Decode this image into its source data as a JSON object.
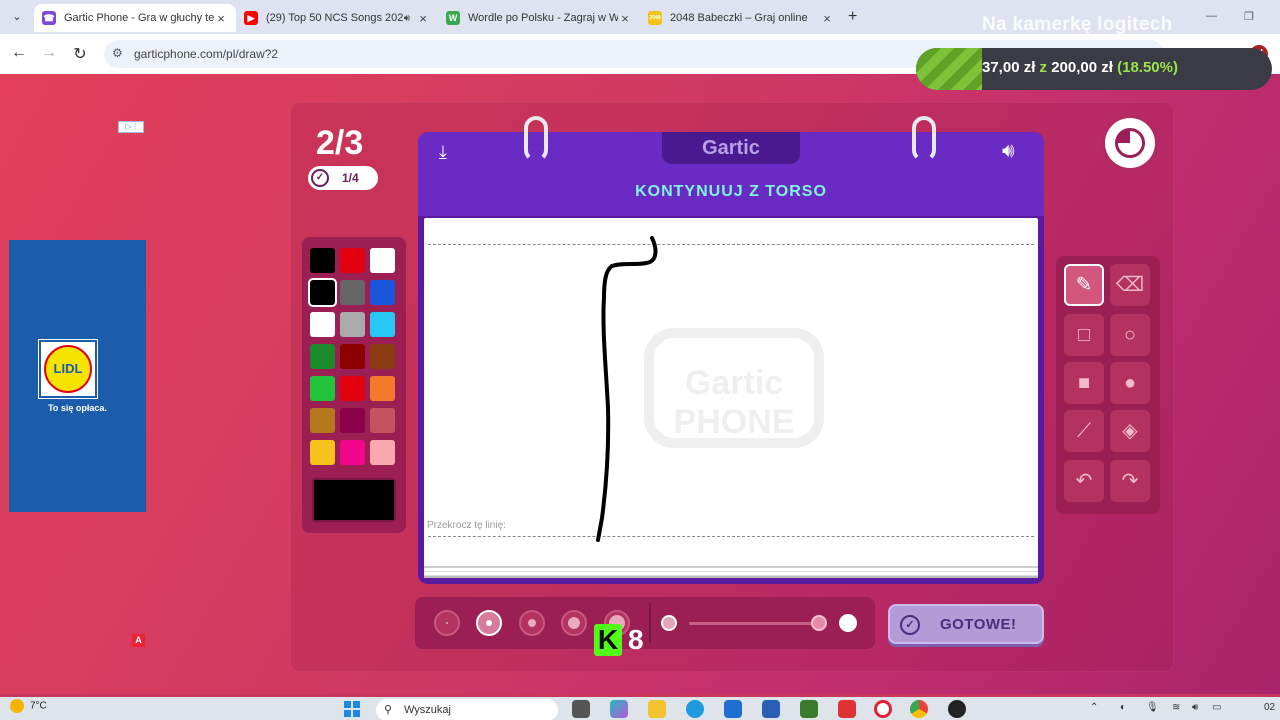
{
  "browser": {
    "tabs": [
      {
        "title": "Gartic Phone - Gra w głuchy tel",
        "active": true,
        "favicon_color": "#7b4bd8"
      },
      {
        "title": "(29) Top 50 NCS Songs 202",
        "active": false,
        "favicon_color": "#ff0000",
        "audio": true
      },
      {
        "title": "Wordle po Polsku - Zagraj w W",
        "active": false,
        "favicon_color": "#3aa84a",
        "favicon_letter": "W"
      },
      {
        "title": "2048 Babeczki – Graj online",
        "active": false,
        "favicon_color": "#f0c419",
        "favicon_letter": "2048"
      }
    ],
    "new_tab_label": "+",
    "url": "garticphone.com/pl/draw?2",
    "profile_initial": "M",
    "stream_overlay_title": "Na kamerkę logitech"
  },
  "donation": {
    "current": "37,00 zł",
    "separator": "z",
    "goal": "200,00 zł",
    "percent_label": "(18.50%)",
    "progress": 0.185
  },
  "ads": {
    "lidl_logo_text": "LIDL",
    "lidl_slogan": "To się opłaca.",
    "corner_badge": "A"
  },
  "game": {
    "round": "2/3",
    "done_count": "1/4",
    "brand": "Gartic",
    "prompt": "KONTYNUUJ Z TORSO",
    "cross_line_label": "Przekrocz tę linię:",
    "watermark_top": "Gartic",
    "watermark_bottom": "PHONE",
    "timer_remaining_fraction": 0.75,
    "done_button": "GOTOWE!",
    "palette": [
      [
        "#000000",
        "#e3000f",
        "#ffffff"
      ],
      [
        "#000000",
        "#666666",
        "#1a56db"
      ],
      [
        "#ffffff",
        "#aaaaaa",
        "#27c8f5"
      ],
      [
        "#1a8a2b",
        "#8c0000",
        "#8c3a12"
      ],
      [
        "#22c23a",
        "#e3000f",
        "#f37a2a"
      ],
      [
        "#b5781c",
        "#8a004a",
        "#c65260"
      ],
      [
        "#f7c21c",
        "#f2078a",
        "#f7a9ae"
      ]
    ],
    "selected_color": "#000000",
    "tools": [
      "pencil-icon",
      "eraser-icon",
      "rectangle-outline-icon",
      "circle-outline-icon",
      "rectangle-filled-icon",
      "circle-filled-icon",
      "line-icon",
      "fill-bucket-icon",
      "undo-icon",
      "redo-icon"
    ],
    "active_tool": "pencil-icon",
    "brush_sizes": 5,
    "selected_brush_size": 2,
    "opacity_value": 1.0
  },
  "stream_overlay": {
    "kick_logo": "K",
    "kick_viewers": "8"
  },
  "taskbar": {
    "temperature": "7°C",
    "search_placeholder": "Wyszukaj",
    "clock": "02"
  }
}
